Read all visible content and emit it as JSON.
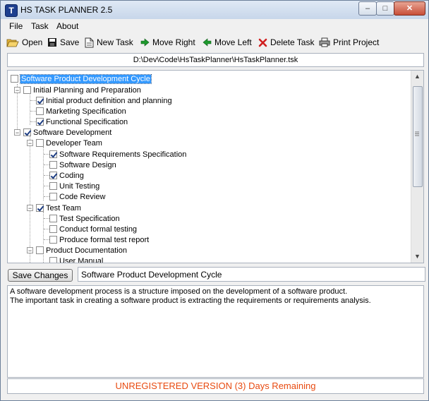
{
  "window": {
    "title": "HS TASK PLANNER 2.5",
    "app_icon_letter": "T"
  },
  "title_buttons": {
    "minimize": "–",
    "maximize": "□",
    "close": "✕"
  },
  "menu": [
    "File",
    "Task",
    "About"
  ],
  "toolbar": {
    "open": "Open",
    "save": "Save",
    "new_task": "New Task",
    "move_right": "Move Right",
    "move_left": "Move Left",
    "delete_task": "Delete Task",
    "print_project": "Print Project"
  },
  "file_path": "D:\\Dev\\Code\\HsTaskPlanner\\HsTaskPlanner.tsk",
  "tree": {
    "nodes": [
      {
        "label": "Software Product Development Cycle",
        "checked": false,
        "selected": true
      },
      {
        "label": "Initial Planning and Preparation",
        "checked": false
      },
      {
        "label": "Initial product definition and planning",
        "checked": true
      },
      {
        "label": "Marketing Specification",
        "checked": false
      },
      {
        "label": "Functional Specification",
        "checked": true
      },
      {
        "label": "Software Development",
        "checked": true
      },
      {
        "label": "Developer Team",
        "checked": false
      },
      {
        "label": "Software Requirements Specification",
        "checked": true
      },
      {
        "label": "Software Design",
        "checked": false
      },
      {
        "label": "Coding",
        "checked": true
      },
      {
        "label": "Unit Testing",
        "checked": false
      },
      {
        "label": "Code Review",
        "checked": false
      },
      {
        "label": "Test Team",
        "checked": true
      },
      {
        "label": "Test Specification",
        "checked": false
      },
      {
        "label": "Conduct formal testing",
        "checked": false
      },
      {
        "label": "Produce formal test report",
        "checked": false
      },
      {
        "label": "Product Documentation",
        "checked": false
      },
      {
        "label": "User Manual",
        "checked": false
      }
    ],
    "expander_collapse": "−"
  },
  "scroll": {
    "up": "▲",
    "down": "▼"
  },
  "save_changes_label": "Save Changes",
  "task_name_value": "Software Product Development Cycle",
  "description": {
    "line1": "A software development process is a structure imposed on the development of a software product.",
    "line2": "The important task in creating a software product is extracting the requirements or requirements analysis."
  },
  "status": "UNREGISTERED VERSION (3) Days Remaining"
}
